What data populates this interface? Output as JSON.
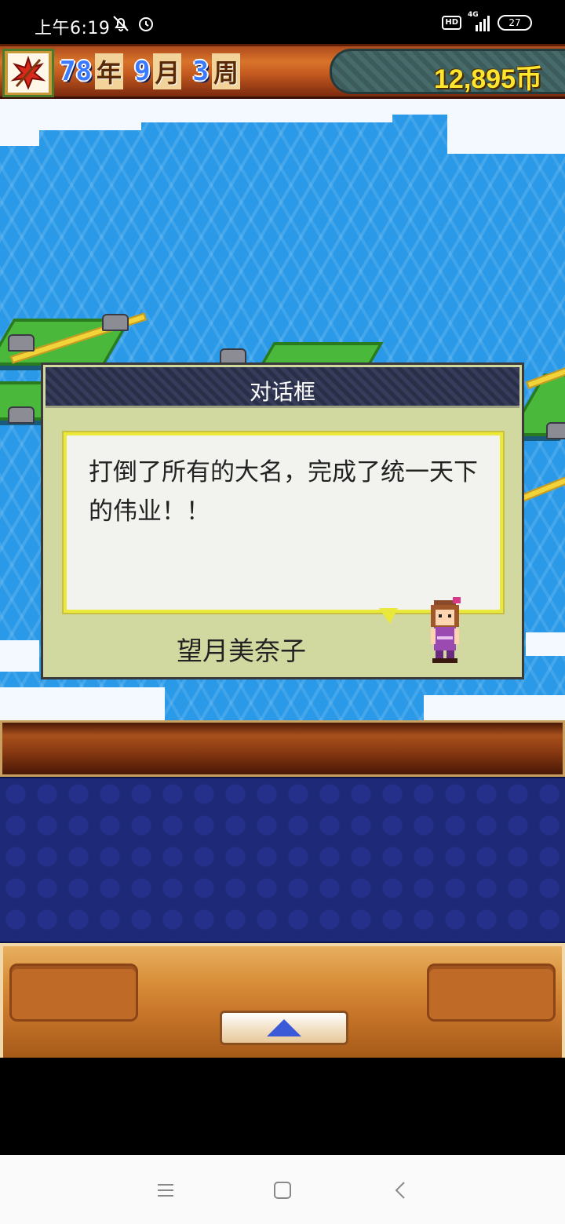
{
  "status_bar": {
    "time": "上午6:19",
    "icons_left": [
      "bell-off-icon",
      "alarm-icon"
    ],
    "hd": "HD",
    "network": "4G",
    "battery": "27"
  },
  "header": {
    "year_num": "78",
    "year_unit": "年",
    "month_num": "9",
    "month_unit": "月",
    "week_num": "3",
    "week_unit": "周",
    "money": "12,895币"
  },
  "dialog": {
    "title": "对话框",
    "message": "打倒了所有的大名，完成了统一天下的伟业！！",
    "speaker": "望月美奈子"
  },
  "nav": [
    "menu-icon",
    "home-icon",
    "back-icon"
  ],
  "colors": {
    "sea": "#2a9ae8",
    "dialog_bg": "#d2d9a0",
    "money_text": "#ffe62e",
    "date_number": "#3a7aff"
  }
}
